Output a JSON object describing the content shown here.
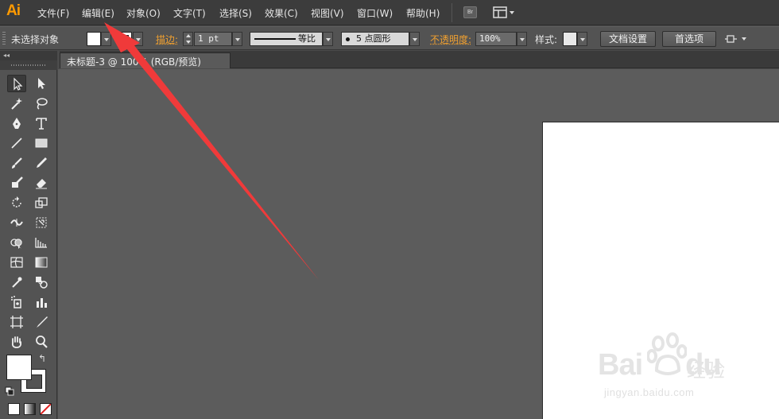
{
  "app": {
    "logo": "Ai",
    "menus": [
      "文件(F)",
      "编辑(E)",
      "对象(O)",
      "文字(T)",
      "选择(S)",
      "效果(C)",
      "视图(V)",
      "窗口(W)",
      "帮助(H)"
    ],
    "bridge_label": "Br",
    "workspace_icon": "workspace-layout-icon"
  },
  "control_bar": {
    "selection_status": "未选择对象",
    "stroke_label": "描边:",
    "stroke_weight": "1 pt",
    "stroke_profile": "等比",
    "brush_definition": "5 点圆形",
    "opacity_label": "不透明度:",
    "opacity_value": "100%",
    "style_label": "样式:",
    "doc_setup_button": "文档设置",
    "preferences_button": "首选项"
  },
  "document": {
    "tab_title": "未标题-3 @ 100% (RGB/预览)"
  },
  "tools_panel": {
    "collapse_glyph": "◂◂",
    "tools": [
      "selection-tool",
      "direct-selection-tool",
      "magic-wand-tool",
      "lasso-tool",
      "pen-tool",
      "type-tool",
      "line-segment-tool",
      "rectangle-tool",
      "paintbrush-tool",
      "pencil-tool",
      "blob-brush-tool",
      "eraser-tool",
      "rotate-tool",
      "scale-tool",
      "width-tool",
      "free-transform-tool",
      "shape-builder-tool",
      "perspective-grid-tool",
      "mesh-tool",
      "gradient-tool",
      "eyedropper-tool",
      "blend-tool",
      "symbol-sprayer-tool",
      "column-graph-tool",
      "artboard-tool",
      "slice-tool",
      "hand-tool",
      "zoom-tool"
    ],
    "fill_color": "#ffffff",
    "stroke_color": "#ffffff"
  },
  "annotation": {
    "arrow_color": "#f03a3a"
  },
  "watermark": {
    "brand": "Bai",
    "brand_suffix": "du",
    "cn_text": "经验",
    "url": "jingyan.baidu.com"
  },
  "colors": {
    "accent": "#ff9a00",
    "link_orange": "#f0a030",
    "canvas": "#5c5c5c",
    "artboard": "#ffffff"
  }
}
